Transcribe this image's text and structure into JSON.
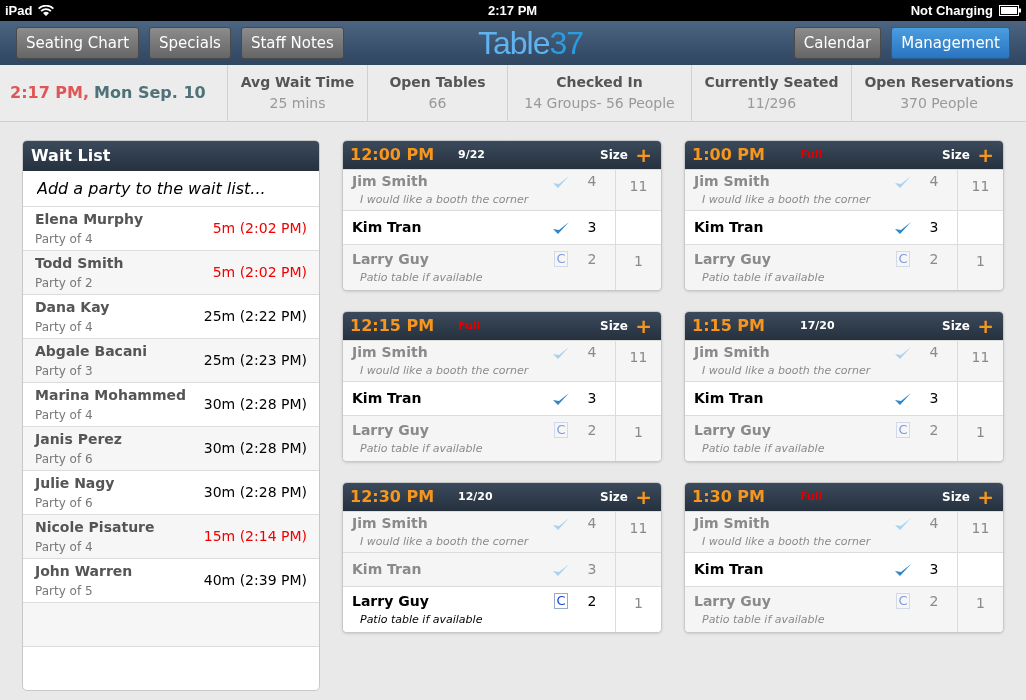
{
  "status_bar": {
    "device": "iPad",
    "time": "2:17 PM",
    "battery": "Not Charging"
  },
  "nav": {
    "left_buttons": [
      {
        "label": "Seating Chart",
        "selected": false
      },
      {
        "label": "Specials",
        "selected": false
      },
      {
        "label": "Staff Notes",
        "selected": false
      }
    ],
    "logo": {
      "word": "Table",
      "number": "37"
    },
    "right_buttons": [
      {
        "label": "Calendar",
        "selected": false
      },
      {
        "label": "Management",
        "selected": true
      }
    ]
  },
  "summary": {
    "time": "2:17 PM,",
    "date": "Mon Sep. 10",
    "stats": [
      {
        "label": "Avg Wait Time",
        "value": "25 mins"
      },
      {
        "label": "Open Tables",
        "value": "66"
      },
      {
        "label": "Checked In",
        "value": "14 Groups- 56 People"
      },
      {
        "label": "Currently Seated",
        "value": "11/296"
      },
      {
        "label": "Open Reservations",
        "value": "370 People"
      }
    ]
  },
  "wait_list": {
    "title": "Wait List",
    "placeholder": "Add a party to the wait list...",
    "parties": [
      {
        "name": "Elena Murphy",
        "party": "Party of 4",
        "wait": "5m (2:02 PM)",
        "overdue": true
      },
      {
        "name": "Todd Smith",
        "party": "Party of 2",
        "wait": "5m (2:02 PM)",
        "overdue": true
      },
      {
        "name": "Dana Kay",
        "party": "Party of 4",
        "wait": "25m (2:22 PM)",
        "overdue": false
      },
      {
        "name": "Abgale Bacani",
        "party": "Party of 3",
        "wait": "25m (2:23 PM)",
        "overdue": false
      },
      {
        "name": "Marina Mohammed",
        "party": "Party of 4",
        "wait": "30m (2:28 PM)",
        "overdue": false
      },
      {
        "name": "Janis Perez",
        "party": "Party of 6",
        "wait": "30m (2:28 PM)",
        "overdue": false
      },
      {
        "name": "Julie Nagy",
        "party": "Party of 6",
        "wait": "30m (2:28 PM)",
        "overdue": false
      },
      {
        "name": "Nicole Pisature",
        "party": "Party of 4",
        "wait": "15m (2:14 PM)",
        "overdue": true
      },
      {
        "name": "John Warren",
        "party": "Party of 5",
        "wait": "40m (2:39 PM)",
        "overdue": false
      }
    ]
  },
  "slots": [
    {
      "time": "12:00 PM",
      "capacity": "9/22",
      "full": false,
      "size_label": "Size",
      "add": "+",
      "reservations": [
        {
          "name": "Jim Smith",
          "note": "I would like a booth the corner",
          "kind": "check",
          "active": false,
          "size": "4",
          "table": "11"
        },
        {
          "name": "Kim Tran",
          "kind": "check",
          "active": true,
          "size": "3"
        },
        {
          "name": "Larry Guy",
          "note": "Patio table if available",
          "kind": "c",
          "mark": "C",
          "active": false,
          "size": "2",
          "table": "1"
        }
      ]
    },
    {
      "time": "1:00 PM",
      "capacity": "Full",
      "full": true,
      "size_label": "Size",
      "add": "+",
      "reservations": [
        {
          "name": "Jim Smith",
          "note": "I would like a booth the corner",
          "kind": "check",
          "active": false,
          "size": "4",
          "table": "11"
        },
        {
          "name": "Kim Tran",
          "kind": "check",
          "active": true,
          "size": "3"
        },
        {
          "name": "Larry Guy",
          "note": "Patio table if available",
          "kind": "c",
          "mark": "C",
          "active": false,
          "size": "2",
          "table": "1"
        }
      ]
    },
    {
      "time": "12:15 PM",
      "capacity": "Full",
      "full": true,
      "size_label": "Size",
      "add": "+",
      "reservations": [
        {
          "name": "Jim Smith",
          "note": "I would like a booth the corner",
          "kind": "check",
          "active": false,
          "size": "4",
          "table": "11"
        },
        {
          "name": "Kim Tran",
          "kind": "check",
          "active": true,
          "size": "3"
        },
        {
          "name": "Larry Guy",
          "note": "Patio table if available",
          "kind": "c",
          "mark": "C",
          "active": false,
          "size": "2",
          "table": "1"
        }
      ]
    },
    {
      "time": "1:15 PM",
      "capacity": "17/20",
      "full": false,
      "size_label": "Size",
      "add": "+",
      "reservations": [
        {
          "name": "Jim Smith",
          "note": "I would like a booth the corner",
          "kind": "check",
          "active": false,
          "size": "4",
          "table": "11"
        },
        {
          "name": "Kim Tran",
          "kind": "check",
          "active": true,
          "size": "3"
        },
        {
          "name": "Larry Guy",
          "note": "Patio table if available",
          "kind": "c",
          "mark": "C",
          "active": false,
          "size": "2",
          "table": "1"
        }
      ]
    },
    {
      "time": "12:30 PM",
      "capacity": "12/20",
      "full": false,
      "size_label": "Size",
      "add": "+",
      "reservations": [
        {
          "name": "Jim Smith",
          "note": "I would like a booth the corner",
          "kind": "check",
          "active": false,
          "size": "4",
          "table": "11"
        },
        {
          "name": "Kim Tran",
          "kind": "check",
          "active": false,
          "size": "3"
        },
        {
          "name": "Larry Guy",
          "note": "Patio table if available",
          "kind": "c",
          "mark": "C",
          "active": true,
          "size": "2",
          "table": "1"
        }
      ]
    },
    {
      "time": "1:30 PM",
      "capacity": "Full",
      "full": true,
      "size_label": "Size",
      "add": "+",
      "reservations": [
        {
          "name": "Jim Smith",
          "note": "I would like a booth the corner",
          "kind": "check",
          "active": false,
          "size": "4",
          "table": "11"
        },
        {
          "name": "Kim Tran",
          "kind": "check",
          "active": true,
          "size": "3"
        },
        {
          "name": "Larry Guy",
          "note": "Patio table if available",
          "kind": "c",
          "mark": "C",
          "active": false,
          "size": "2",
          "table": "1"
        }
      ]
    }
  ]
}
